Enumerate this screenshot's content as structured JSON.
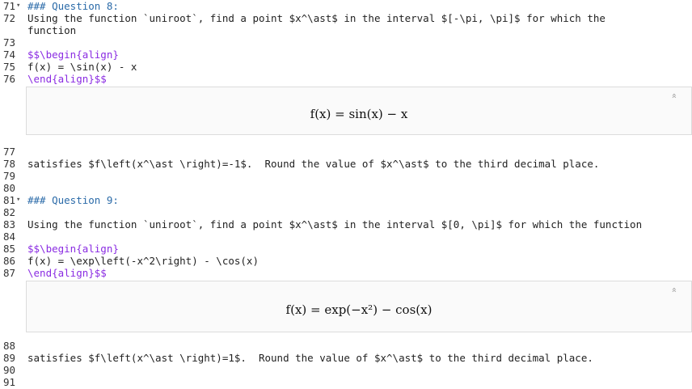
{
  "lines": [
    {
      "n": "71",
      "fold": true,
      "text": "### Question 8:",
      "kind": "heading"
    },
    {
      "n": "72",
      "fold": false,
      "text": "Using the function `uniroot`, find a point $x^\\ast$ in the interval $[-\\pi, \\pi]$ for which the",
      "kind": "prose"
    },
    {
      "n": "",
      "fold": false,
      "text": "function",
      "kind": "prose"
    },
    {
      "n": "73",
      "fold": false,
      "text": "",
      "kind": "prose"
    },
    {
      "n": "74",
      "fold": false,
      "text": "$$\\begin{align}",
      "kind": "tex"
    },
    {
      "n": "75",
      "fold": false,
      "text": "f(x) = \\sin(x) - x",
      "kind": "prose"
    },
    {
      "n": "76",
      "fold": false,
      "text": "\\end{align}$$",
      "kind": "tex"
    },
    {
      "n": "77",
      "fold": false,
      "text": "",
      "kind": "prose"
    },
    {
      "n": "78",
      "fold": false,
      "text": "satisfies $f\\left(x^\\ast \\right)=-1$.  Round the value of $x^\\ast$ to the third decimal place.",
      "kind": "prose"
    },
    {
      "n": "79",
      "fold": false,
      "text": "",
      "kind": "prose"
    },
    {
      "n": "80",
      "fold": false,
      "text": "",
      "kind": "prose"
    },
    {
      "n": "81",
      "fold": true,
      "text": "### Question 9:",
      "kind": "heading"
    },
    {
      "n": "82",
      "fold": false,
      "text": "",
      "kind": "prose"
    },
    {
      "n": "83",
      "fold": false,
      "text": "Using the function `uniroot`, find a point $x^\\ast$ in the interval $[0, \\pi]$ for which the function",
      "kind": "prose"
    },
    {
      "n": "84",
      "fold": false,
      "text": "",
      "kind": "prose"
    },
    {
      "n": "85",
      "fold": false,
      "text": "$$\\begin{align}",
      "kind": "tex"
    },
    {
      "n": "86",
      "fold": false,
      "text": "f(x) = \\exp\\left(-x^2\\right) - \\cos(x)",
      "kind": "prose"
    },
    {
      "n": "87",
      "fold": false,
      "text": "\\end{align}$$",
      "kind": "tex"
    },
    {
      "n": "88",
      "fold": false,
      "text": "",
      "kind": "prose"
    },
    {
      "n": "89",
      "fold": false,
      "text": "satisfies $f\\left(x^\\ast \\right)=1$.  Round the value of $x^\\ast$ to the third decimal place.",
      "kind": "prose"
    },
    {
      "n": "90",
      "fold": false,
      "text": "",
      "kind": "prose"
    },
    {
      "n": "91",
      "fold": false,
      "text": "",
      "kind": "prose"
    }
  ],
  "previews": [
    {
      "math": "f(x) = sin(x) − x",
      "collapse_icon": "double-chevron-up-icon"
    },
    {
      "math": "f(x) = exp(−x²) − cos(x)",
      "collapse_icon": "double-chevron-up-icon"
    }
  ],
  "fold_glyph": "▾",
  "collapse_glyph": "»"
}
